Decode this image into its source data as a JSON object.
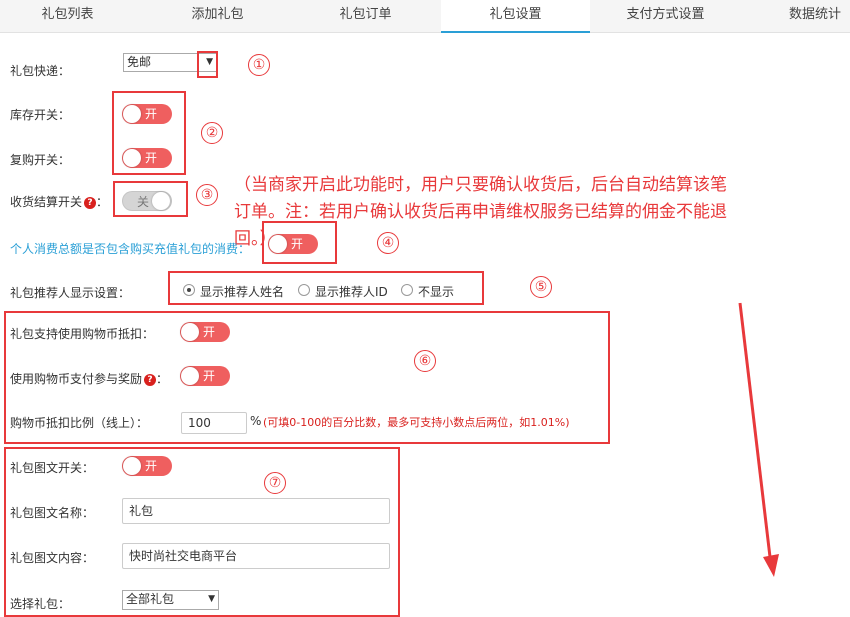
{
  "tabs": [
    {
      "label": "礼包列表"
    },
    {
      "label": "添加礼包"
    },
    {
      "label": "礼包订单"
    },
    {
      "label": "礼包设置"
    },
    {
      "label": "支付方式设置"
    },
    {
      "label": "数据统计"
    }
  ],
  "express": {
    "label": "礼包快递：",
    "value": "免邮"
  },
  "stock": {
    "label": "库存开关：",
    "toggle": "开"
  },
  "rebuy": {
    "label": "复购开关：",
    "toggle": "开"
  },
  "settle": {
    "label": "收货结算开关",
    "toggle": "关"
  },
  "note": {
    "line1": "（当商家开启此功能时，用户只要确认收货后，后台自动结算该笔",
    "line2": "订单。注：若用户确认收货后再申请维权服务已结算的佣金不能退",
    "line3": "回。）"
  },
  "consume": {
    "label": "个人消费总额是否包含购买充值礼包的消费：",
    "toggle": "开"
  },
  "referrer": {
    "label": "礼包推荐人显示设置：",
    "options": [
      "显示推荐人姓名",
      "显示推荐人ID",
      "不显示"
    ],
    "selected": 0
  },
  "coin_deduct": {
    "label": "礼包支持使用购物币抵扣：",
    "toggle": "开"
  },
  "coin_reward": {
    "label": "使用购物币支付参与奖励",
    "toggle": "开"
  },
  "coin_ratio": {
    "label": "购物币抵扣比例（线上）：",
    "value": "100",
    "unit": "%",
    "hint": "(可填0-100的百分比数，最多可支持小数点后两位，如1.01%)"
  },
  "graphic": {
    "label": "礼包图文开关：",
    "toggle": "开"
  },
  "graphic_name": {
    "label": "礼包图文名称：",
    "value": "礼包"
  },
  "graphic_content": {
    "label": "礼包图文内容：",
    "value": "快时尚社交电商平台"
  },
  "select_pack": {
    "label": "选择礼包：",
    "value": "全部礼包"
  },
  "annotations": [
    "①",
    "②",
    "③",
    "④",
    "⑤",
    "⑥",
    "⑦"
  ],
  "accent_color": "#e8393b",
  "toggle_on_color": "#ef5f5f"
}
